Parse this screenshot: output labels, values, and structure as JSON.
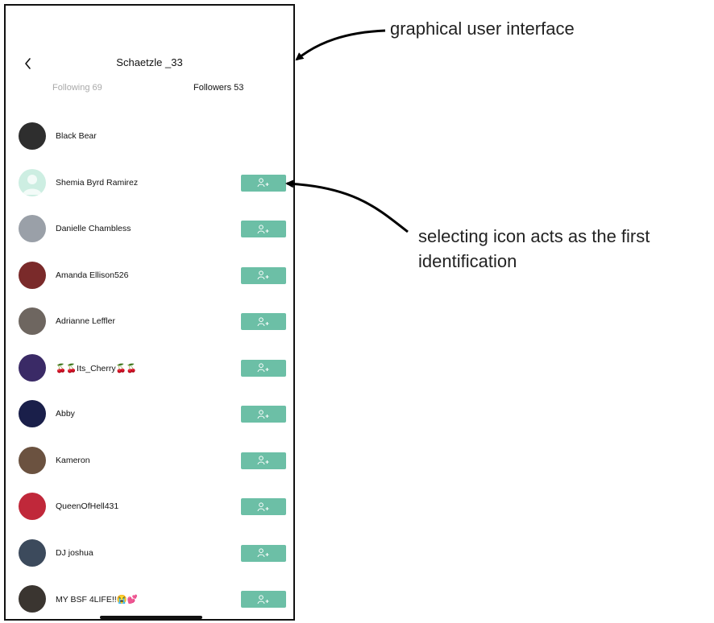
{
  "header": {
    "title": "Schaetzle _33",
    "back_icon": "chevron-left-icon"
  },
  "tabs": [
    {
      "label": "Following 69",
      "active": false
    },
    {
      "label": "Followers 53",
      "active": true
    }
  ],
  "followers": [
    {
      "name": "Black Bear",
      "follow_button": false,
      "avatar_color": "#2e2e2e"
    },
    {
      "name": "Shemia Byrd Ramirez",
      "follow_button": true,
      "avatar_color": "#cdeee2"
    },
    {
      "name": "Danielle Chambless",
      "follow_button": true,
      "avatar_color": "#9aa0a8"
    },
    {
      "name": "Amanda Ellison526",
      "follow_button": true,
      "avatar_color": "#7a2a2a"
    },
    {
      "name": "Adrianne Leffler",
      "follow_button": true,
      "avatar_color": "#6e6660"
    },
    {
      "name": "🍒🍒Its_Cherry🍒🍒",
      "follow_button": true,
      "avatar_color": "#3a2a66"
    },
    {
      "name": "Abby",
      "follow_button": true,
      "avatar_color": "#1a1f4a"
    },
    {
      "name": "Kameron",
      "follow_button": true,
      "avatar_color": "#6b5240"
    },
    {
      "name": "QueenOfHell431",
      "follow_button": true,
      "avatar_color": "#c0283a"
    },
    {
      "name": "DJ joshua",
      "follow_button": true,
      "avatar_color": "#3c4a5c"
    },
    {
      "name": "MY BSF 4LIFE!!😭💕",
      "follow_button": true,
      "avatar_color": "#3a3530"
    }
  ],
  "follow_button_icon": "add-user-icon",
  "colors": {
    "accent": "#6cbfa6",
    "inactive_tab": "#a9a9a9",
    "text": "#111111"
  },
  "annotations": {
    "gui_label": "graphical user interface",
    "icon_label": "selecting icon acts as the first identification"
  }
}
